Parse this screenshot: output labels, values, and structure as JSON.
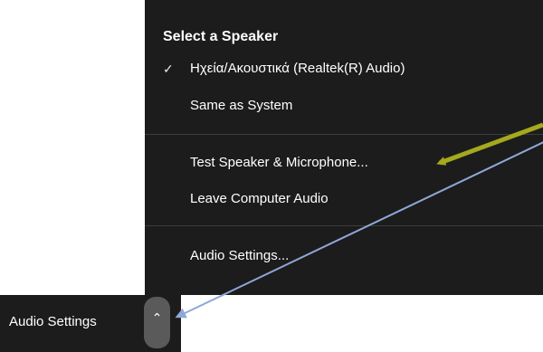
{
  "menu": {
    "section_title": "Select a Speaker",
    "speakers": [
      {
        "label": "Ηχεία/Ακουστικά (Realtek(R) Audio)",
        "selected": true
      },
      {
        "label": "Same as System",
        "selected": false
      }
    ],
    "check_glyph": "✓",
    "actions": [
      {
        "label": "Test Speaker & Microphone..."
      },
      {
        "label": "Leave Computer Audio"
      }
    ],
    "settings_label": "Audio Settings..."
  },
  "toolbar": {
    "label": "Audio Settings",
    "chevron_glyph": "⌃"
  },
  "annotations": {
    "arrow_colors": {
      "olive": "#a6a81e",
      "blue": "#8ea8d8"
    }
  },
  "colors": {
    "menu_bg": "#1c1c1c",
    "text": "#ffffff",
    "chevron_bg": "#5a5a5a"
  }
}
